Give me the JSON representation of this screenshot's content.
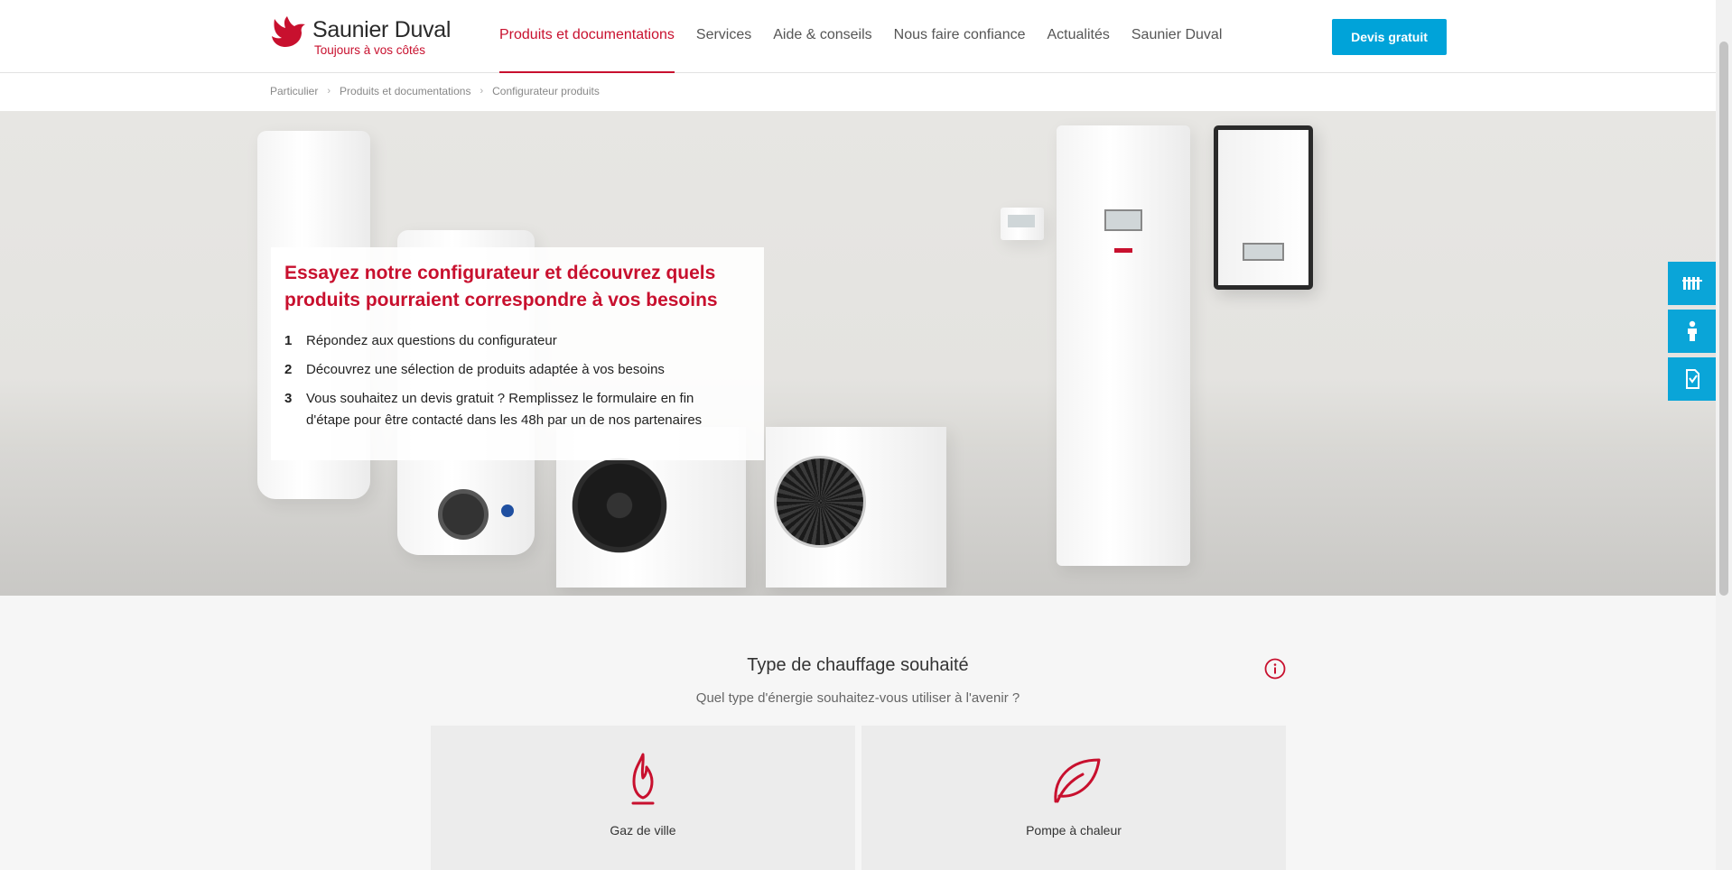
{
  "brand": {
    "name": "Saunier Duval",
    "tagline": "Toujours à vos côtés"
  },
  "nav": {
    "items": [
      {
        "label": "Produits et documentations",
        "active": true
      },
      {
        "label": "Services",
        "active": false
      },
      {
        "label": "Aide & conseils",
        "active": false
      },
      {
        "label": "Nous faire confiance",
        "active": false
      },
      {
        "label": "Actualités",
        "active": false
      },
      {
        "label": "Saunier Duval",
        "active": false
      }
    ],
    "cta_label": "Devis gratuit"
  },
  "breadcrumb": [
    "Particulier",
    "Produits et documentations",
    "Configurateur produits"
  ],
  "hero": {
    "title": "Essayez notre configurateur et découvrez quels produits pourraient correspondre à vos besoins",
    "steps": [
      {
        "num": "1",
        "text": "Répondez aux questions du configurateur"
      },
      {
        "num": "2",
        "text": "Découvrez une sélection de produits adaptée à vos besoins"
      },
      {
        "num": "3",
        "text": "Vous souhaitez un devis gratuit ? Remplissez le formulaire en fin d'étape pour être contacté dans les 48h par un de nos partenaires"
      }
    ]
  },
  "side_tools": [
    {
      "icon": "radiator-icon"
    },
    {
      "icon": "installer-icon"
    },
    {
      "icon": "quote-document-icon"
    }
  ],
  "section": {
    "title": "Type de chauffage souhaité",
    "subtitle": "Quel type d'énergie souhaitez-vous utiliser à l'avenir ?",
    "options": [
      {
        "label": "Gaz de ville",
        "icon": "flame-icon"
      },
      {
        "label": "Pompe à chaleur",
        "icon": "leaf-icon"
      }
    ]
  },
  "colors": {
    "brand_red": "#c8102e",
    "cta_blue": "#00a3d9"
  }
}
